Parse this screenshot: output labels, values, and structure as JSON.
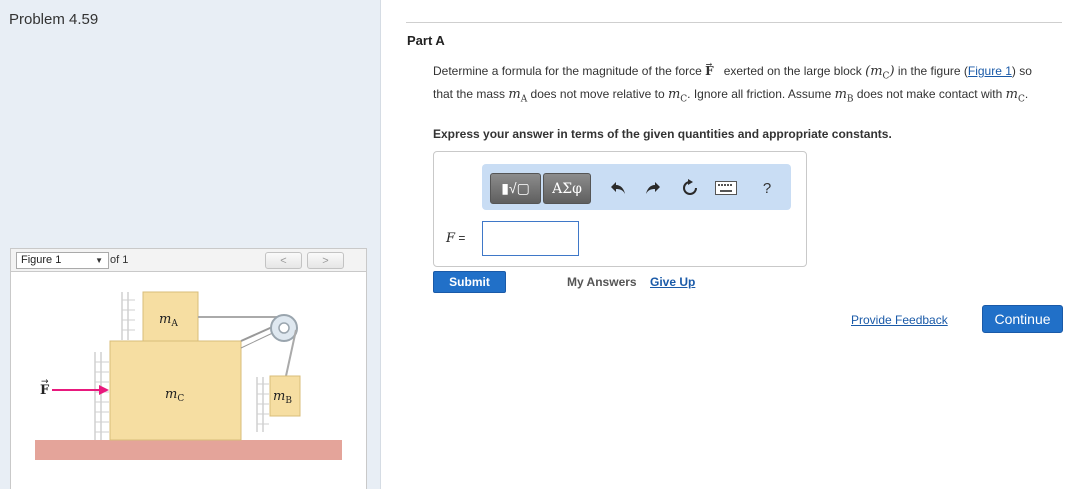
{
  "problem": {
    "title": "Problem 4.59"
  },
  "figure_nav": {
    "selected": "Figure 1",
    "of_label": "of 1",
    "prev_icon": "chevron-left-icon",
    "next_icon": "chevron-right-icon"
  },
  "figure": {
    "label_mA": "m",
    "label_mA_sub": "A",
    "label_mC": "m",
    "label_mC_sub": "C",
    "label_mB": "m",
    "label_mB_sub": "B",
    "force_label": "F",
    "arrow_color": "#e8197d",
    "block_color": "#f6dea2",
    "ground_color": "#e4a49a"
  },
  "part": {
    "title": "Part A"
  },
  "question": {
    "text1": "Determine a formula for the magnitude of the force ",
    "force": "F",
    "text2": " exerted on the large block ",
    "mC_open": "(",
    "mC_m": "m",
    "mC_sub": "C",
    "mC_close": ")",
    "text3": " in the figure ",
    "link_open": "(",
    "link": "Figure 1",
    "link_close": ")",
    "text4": " so that the mass ",
    "mA_m": "m",
    "mA_sub": "A",
    "text5": " does not move relative to ",
    "mC2_m": "m",
    "mC2_sub": "C",
    "text6": ". Ignore all friction. Assume ",
    "mB_m": "m",
    "mB_sub": "B",
    "text7": " does not make contact with ",
    "mC3_m": "m",
    "mC3_sub": "C",
    "text8": "."
  },
  "instruction": "Express your answer in terms of the given quantities and appropriate constants.",
  "toolbar": {
    "template_label": "▮√▢",
    "greek_label": "ΑΣφ",
    "undo_icon": "undo-icon",
    "redo_icon": "redo-icon",
    "reset_icon": "reset-icon",
    "keyboard_icon": "keyboard-icon",
    "help_label": "?"
  },
  "answer": {
    "label": "F",
    "equals": " =",
    "value": ""
  },
  "actions": {
    "submit": "Submit",
    "my_answers": "My Answers",
    "give_up": "Give Up",
    "feedback": "Provide Feedback",
    "continue": "Continue"
  },
  "colors": {
    "accent": "#2170c8",
    "link": "#1a5aa8",
    "toolbar_bg": "#c9ddf4"
  }
}
